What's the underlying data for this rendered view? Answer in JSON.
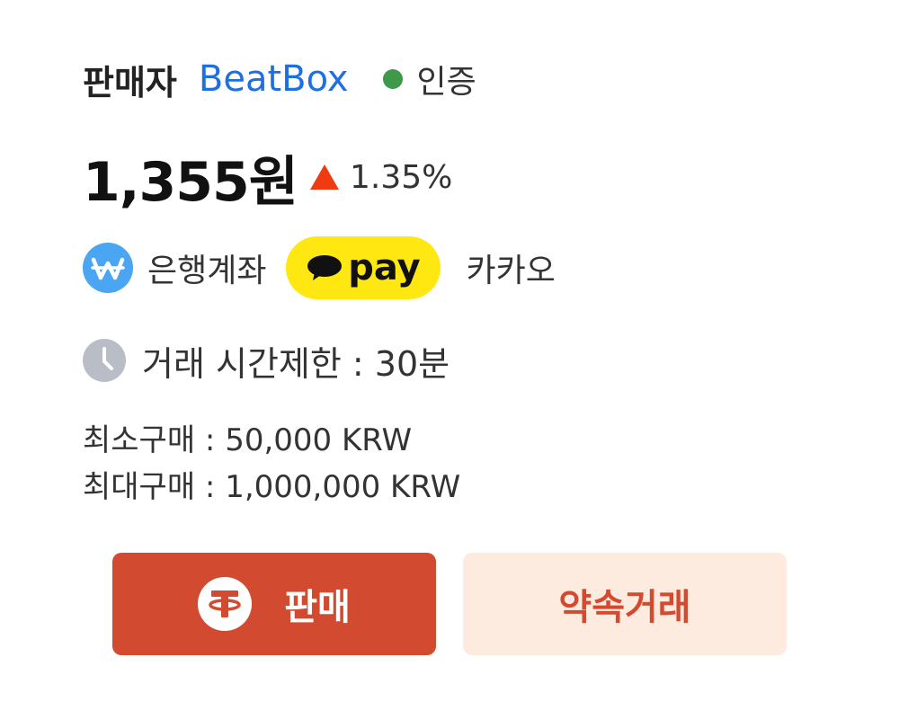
{
  "seller": {
    "label": "판매자",
    "name": "BeatBox",
    "verified_label": "인증",
    "verified_color": "#3e9a4a"
  },
  "price": {
    "value": "1,355원",
    "change": "1.35%",
    "change_direction": "up",
    "change_color": "#ef3a12"
  },
  "payment": {
    "bank_icon": "won-icon",
    "bank_label": "은행계좌",
    "kakao_icon": "kakaopay-logo",
    "kakao_pay_text": "pay",
    "kakao_label": "카카오"
  },
  "time_limit": {
    "icon": "clock-icon",
    "label": "거래 시간제한 : 30분"
  },
  "limits": {
    "min": "최소구매 : 50,000  KRW",
    "max": "최대구매 : 1,000,000 KRW"
  },
  "buttons": {
    "sell_icon": "tether-icon",
    "sell_label": "판매",
    "sell_color": "#d24b30",
    "promise_label": "약속거래",
    "promise_bg": "#feebe0"
  }
}
